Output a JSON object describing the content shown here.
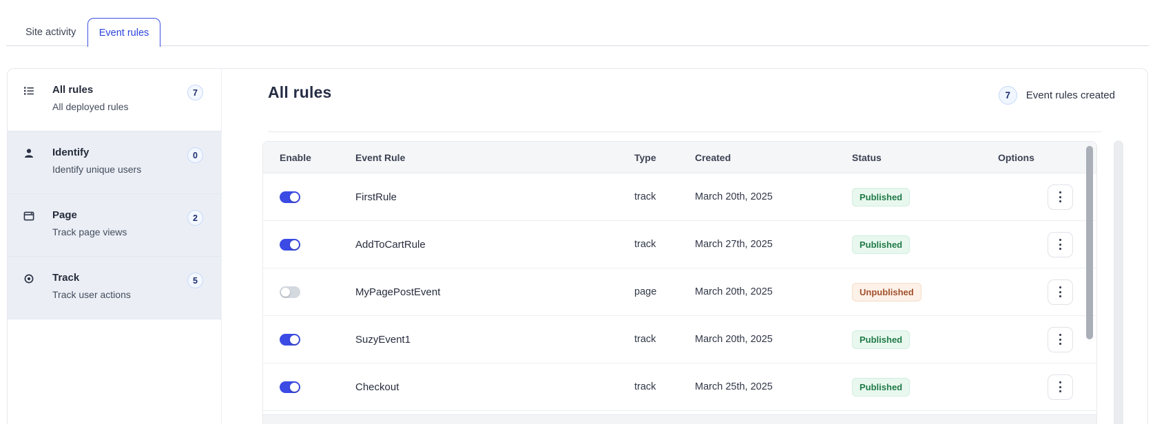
{
  "tabs": [
    {
      "label": "Site activity",
      "active": false
    },
    {
      "label": "Event rules",
      "active": true
    }
  ],
  "sidebar": {
    "items": [
      {
        "icon": "list-icon",
        "title": "All rules",
        "subtitle": "All deployed rules",
        "count": "7",
        "active": true
      },
      {
        "icon": "person-icon",
        "title": "Identify",
        "subtitle": "Identify unique users",
        "count": "0",
        "active": false
      },
      {
        "icon": "window-icon",
        "title": "Page",
        "subtitle": "Track page views",
        "count": "2",
        "active": false
      },
      {
        "icon": "target-icon",
        "title": "Track",
        "subtitle": "Track user actions",
        "count": "5",
        "active": false
      }
    ]
  },
  "main": {
    "title": "All rules",
    "summary": {
      "count": "7",
      "label": "Event rules created"
    },
    "table": {
      "columns": [
        "Enable",
        "Event Rule",
        "Type",
        "Created",
        "Status",
        "Options"
      ],
      "rows": [
        {
          "enabled": true,
          "name": "FirstRule",
          "type": "track",
          "created": "March 20th, 2025",
          "status": "Published"
        },
        {
          "enabled": true,
          "name": "AddToCartRule",
          "type": "track",
          "created": "March 27th, 2025",
          "status": "Published"
        },
        {
          "enabled": false,
          "name": "MyPagePostEvent",
          "type": "page",
          "created": "March 20th, 2025",
          "status": "Unpublished"
        },
        {
          "enabled": true,
          "name": "SuzyEvent1",
          "type": "track",
          "created": "March 20th, 2025",
          "status": "Published"
        },
        {
          "enabled": true,
          "name": "Checkout",
          "type": "track",
          "created": "March 25th, 2025",
          "status": "Published"
        }
      ]
    }
  },
  "colors": {
    "accent_blue": "#3b4be4",
    "tab_blue": "#2b43dd",
    "published_text": "#217a48",
    "published_bg": "#e9f8ef",
    "unpublished_text": "#a2512d",
    "unpublished_bg": "#fdf1e8",
    "sidebar_tint": "#ebeff5",
    "count_badge_border": "#c7d8f8"
  }
}
